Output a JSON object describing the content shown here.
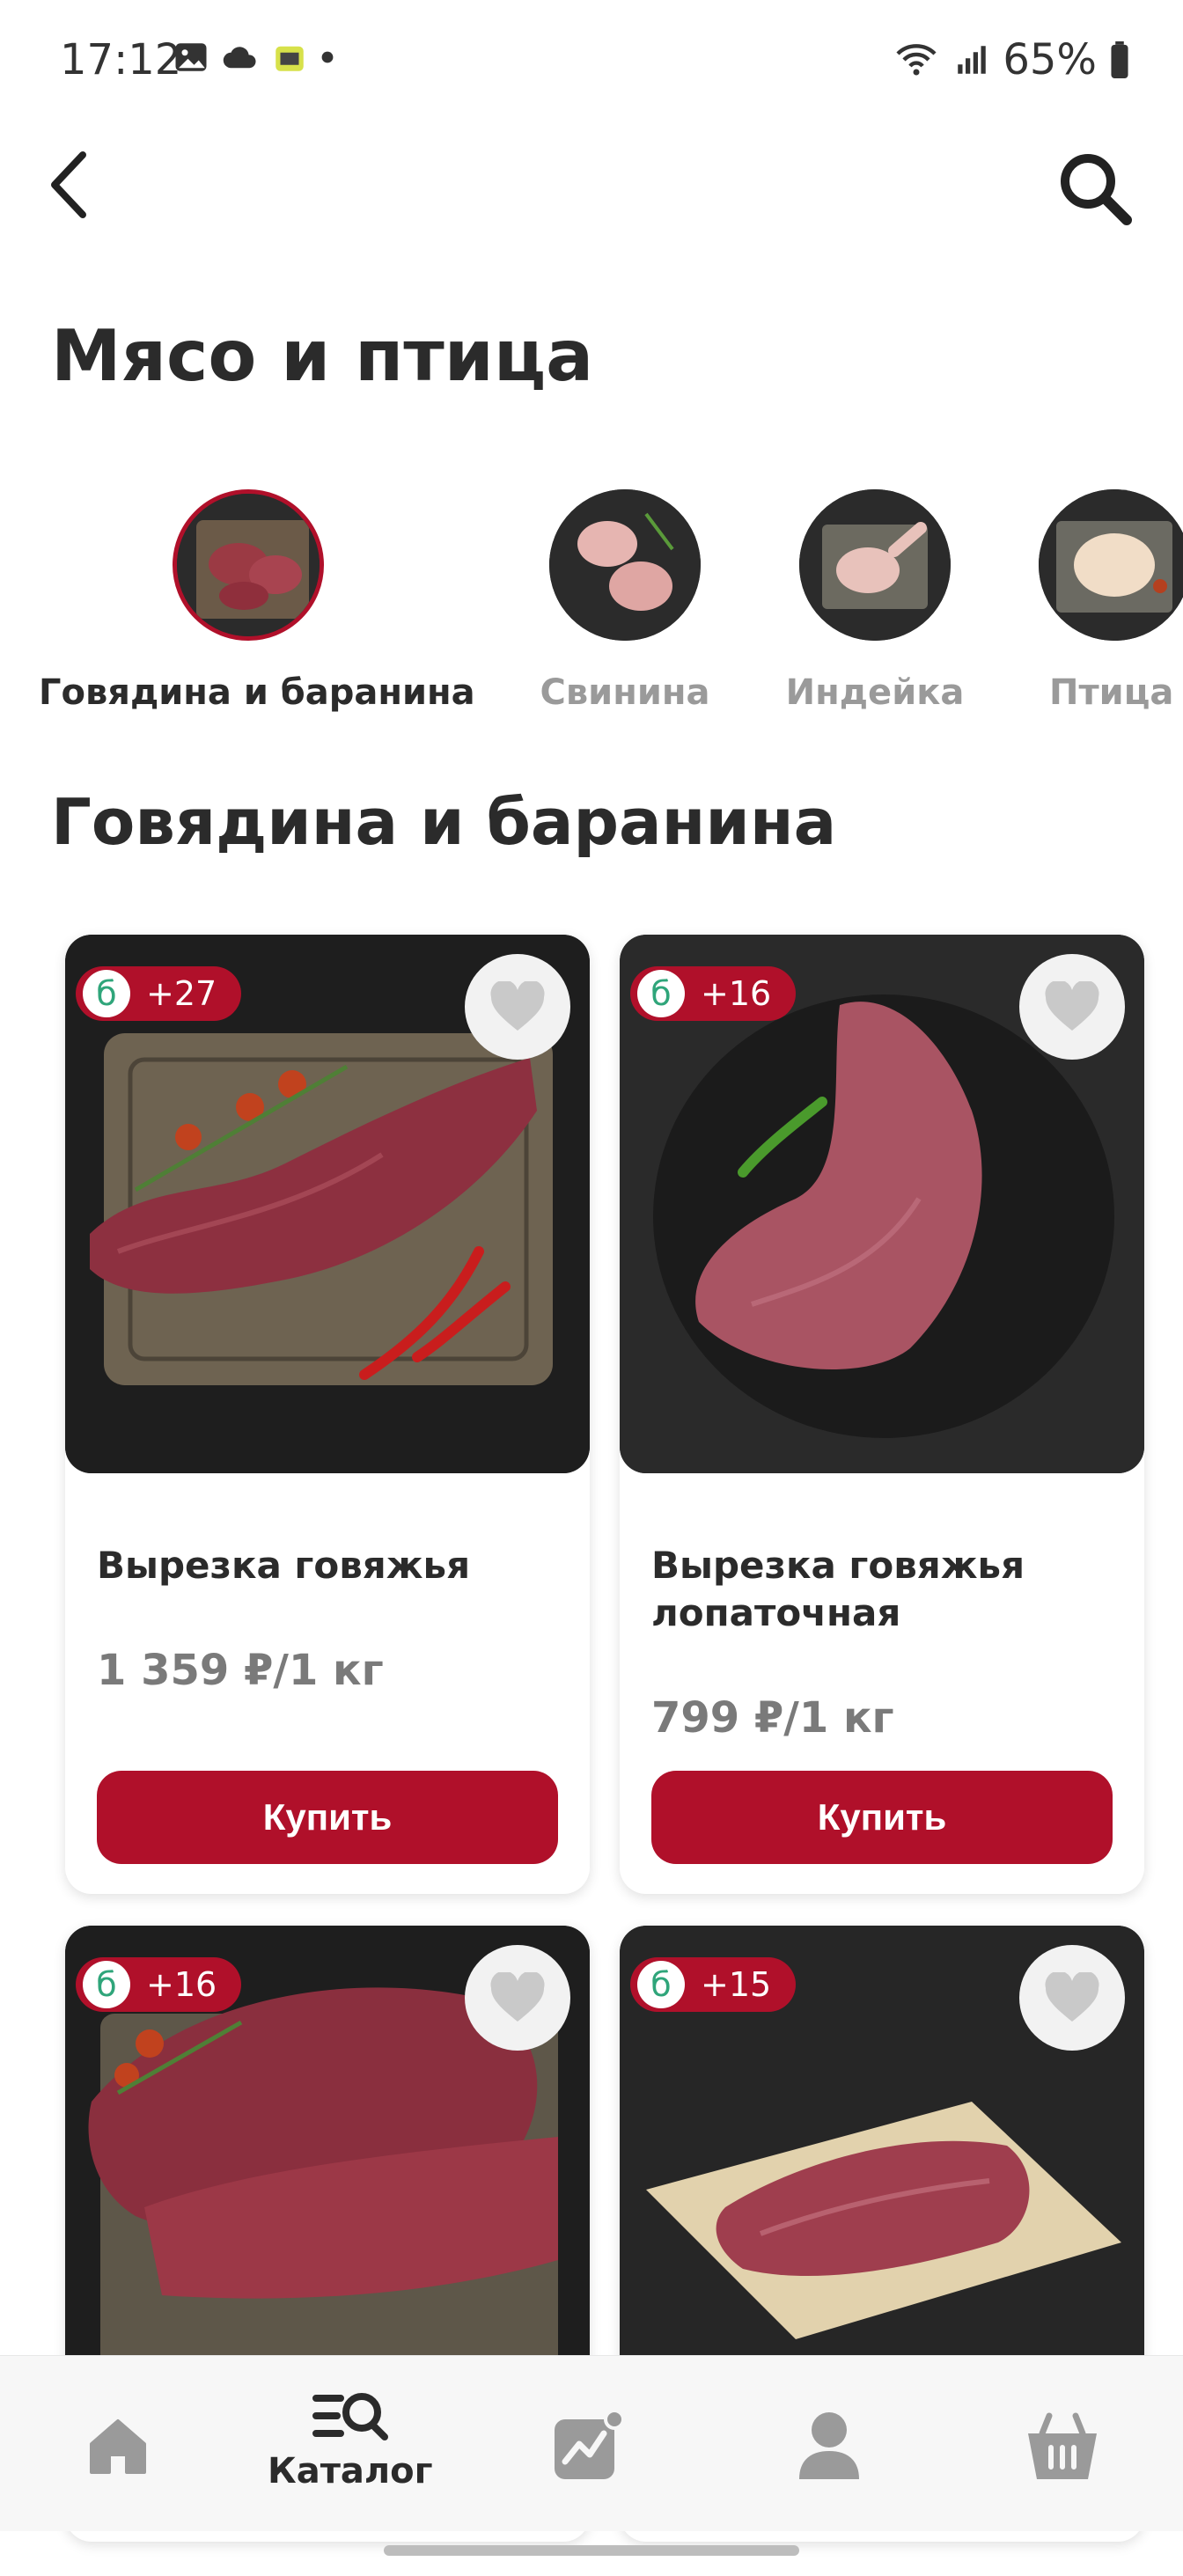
{
  "status_bar": {
    "time": "17:12",
    "battery": "65%",
    "icons": [
      "image-icon",
      "cloud-icon",
      "app-icon",
      "dot-icon",
      "wifi-icon",
      "signal-icon",
      "battery-icon"
    ]
  },
  "header": {
    "back_icon": "back-arrow-icon",
    "search_icon": "search-icon",
    "title": "Мясо и птица"
  },
  "subcategories": [
    {
      "label": "Говядина и баранина",
      "active": true
    },
    {
      "label": "Свинина",
      "active": false
    },
    {
      "label": "Индейка",
      "active": false
    },
    {
      "label": "Птица",
      "active": false
    }
  ],
  "section_title": "Говядина и баранина",
  "products": [
    {
      "name": "Вырезка говяжья",
      "price": "1 359 ₽/1 кг",
      "bonus_coin": "б",
      "bonus": "+27",
      "buy_label": "Купить"
    },
    {
      "name": "Вырезка говяжья лопаточная",
      "price": "799 ₽/1 кг",
      "bonus_coin": "б",
      "bonus": "+16",
      "buy_label": "Купить"
    },
    {
      "name": "",
      "price": "",
      "bonus_coin": "б",
      "bonus": "+16",
      "buy_label": ""
    },
    {
      "name": "",
      "price": "",
      "bonus_coin": "б",
      "bonus": "+15",
      "buy_label": ""
    }
  ],
  "bottom_nav": {
    "items": [
      {
        "icon": "home-icon",
        "label": ""
      },
      {
        "icon": "catalog-icon",
        "label": "Каталог"
      },
      {
        "icon": "promo-chart-icon",
        "label": ""
      },
      {
        "icon": "profile-icon",
        "label": ""
      },
      {
        "icon": "cart-icon",
        "label": ""
      }
    ]
  },
  "colors": {
    "accent": "#b0102a",
    "text_dark": "#2b2b2b",
    "text_muted": "#9a9a9a",
    "bonus_green": "#2fa57a"
  }
}
